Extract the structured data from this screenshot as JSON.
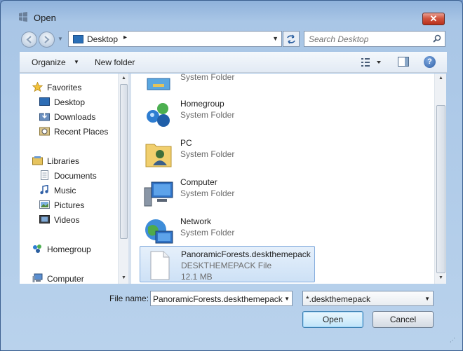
{
  "window": {
    "title": "Open",
    "close_glyph": "✕"
  },
  "nav": {
    "address_location": "Desktop",
    "address_separator": "▸",
    "search_placeholder": "Search Desktop"
  },
  "toolbar": {
    "organize_label": "Organize",
    "new_folder_label": "New folder"
  },
  "sidebar": {
    "items": [
      {
        "label": "Favorites",
        "icon": "star-icon",
        "level": 0
      },
      {
        "label": "Desktop",
        "icon": "desktop-icon",
        "level": 1
      },
      {
        "label": "Downloads",
        "icon": "downloads-icon",
        "level": 1
      },
      {
        "label": "Recent Places",
        "icon": "recent-places-icon",
        "level": 1
      },
      {
        "label": "Libraries",
        "icon": "libraries-icon",
        "level": 0
      },
      {
        "label": "Documents",
        "icon": "documents-icon",
        "level": 1
      },
      {
        "label": "Music",
        "icon": "music-icon",
        "level": 1
      },
      {
        "label": "Pictures",
        "icon": "pictures-icon",
        "level": 1
      },
      {
        "label": "Videos",
        "icon": "videos-icon",
        "level": 1
      },
      {
        "label": "Homegroup",
        "icon": "homegroup-icon",
        "level": 0
      },
      {
        "label": "Computer",
        "icon": "computer-icon",
        "level": 0
      }
    ]
  },
  "files": [
    {
      "name": "",
      "type": "System Folder",
      "icon": "folder-partial-icon"
    },
    {
      "name": "Homegroup",
      "type": "System Folder",
      "icon": "homegroup-icon"
    },
    {
      "name": "PC",
      "type": "System Folder",
      "icon": "user-folder-icon"
    },
    {
      "name": "Computer",
      "type": "System Folder",
      "icon": "computer-icon"
    },
    {
      "name": "Network",
      "type": "System Folder",
      "icon": "network-icon"
    },
    {
      "name": "PanoramicForests.deskthemepack",
      "type": "DESKTHEMEPACK File",
      "size": "12.1 MB",
      "icon": "file-icon",
      "selected": true
    }
  ],
  "footer": {
    "file_name_label": "File name:",
    "file_name_value": "PanoramicForests.deskthemepack",
    "file_type_value": "*.deskthemepack",
    "open_label": "Open",
    "cancel_label": "Cancel"
  },
  "colors": {
    "accent": "#2f5fa6",
    "selection": "#cde1f6",
    "close": "#c7402a"
  }
}
